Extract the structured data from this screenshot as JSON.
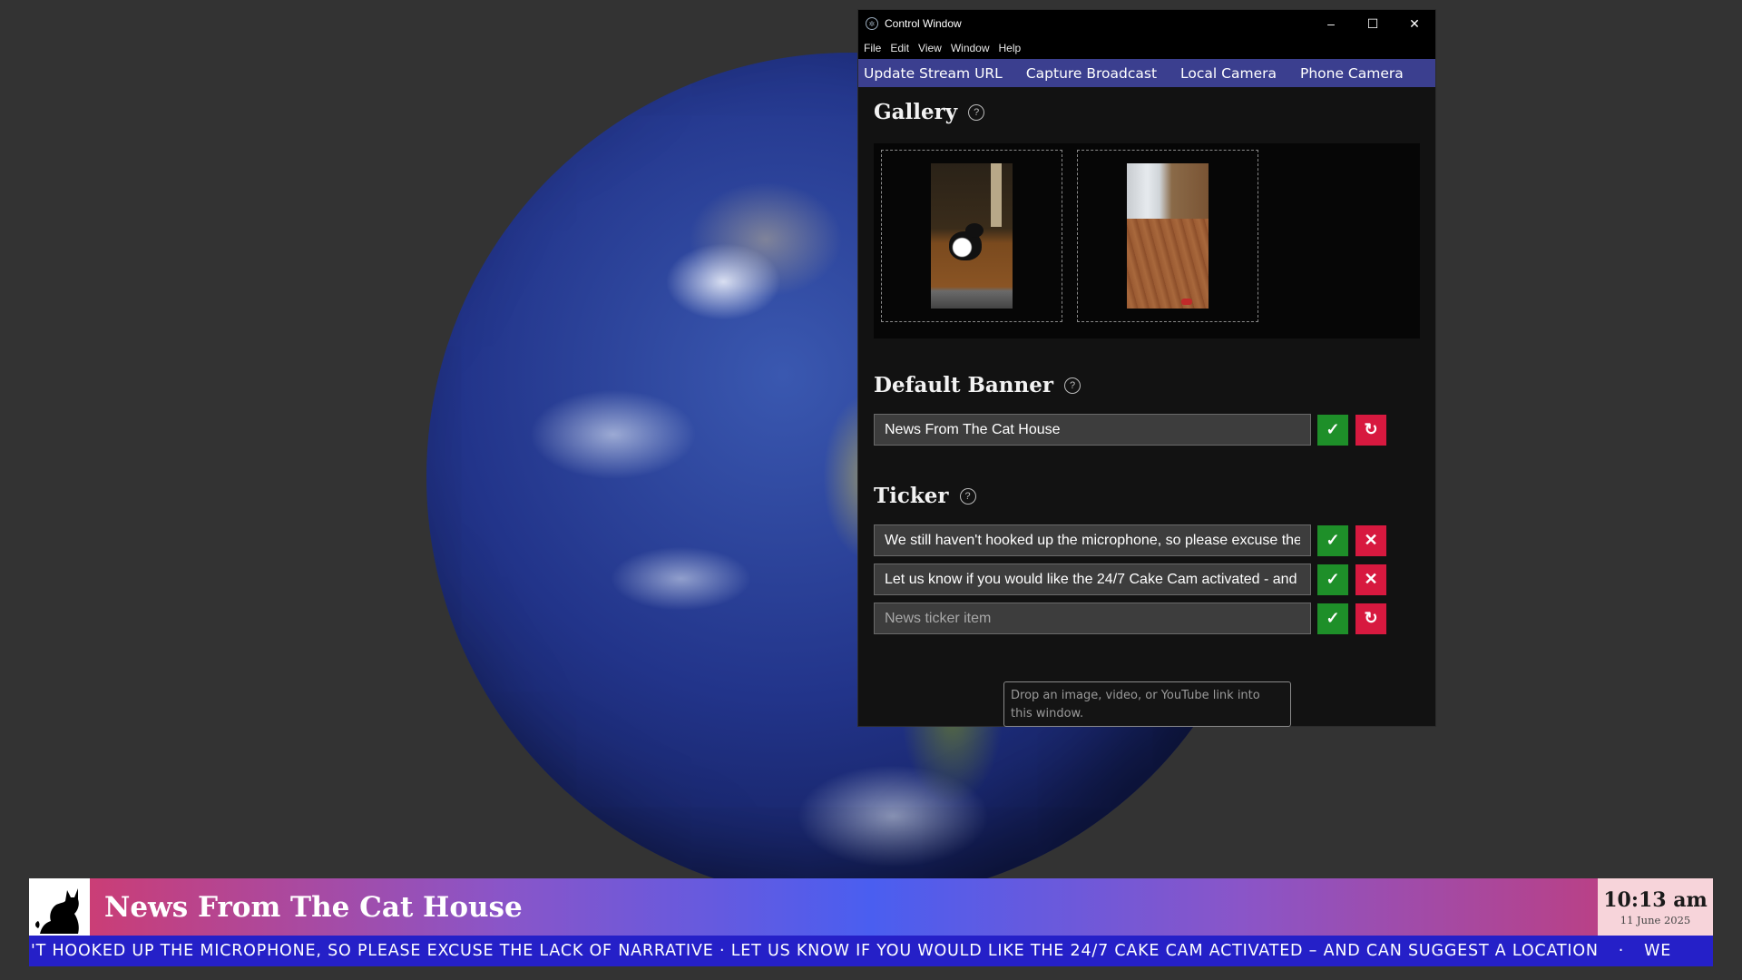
{
  "window": {
    "title": "Control Window",
    "controls": {
      "minimize": "–",
      "maximize": "☐",
      "close": "✕"
    }
  },
  "menu": [
    "File",
    "Edit",
    "View",
    "Window",
    "Help"
  ],
  "tabs": [
    "Update Stream URL",
    "Capture Broadcast",
    "Local Camera",
    "Phone Camera"
  ],
  "gallery": {
    "title": "Gallery",
    "help": "?"
  },
  "default_banner": {
    "title": "Default Banner",
    "help": "?",
    "value": "News From The Cat House",
    "confirm": "✓",
    "reset": "↻"
  },
  "ticker_section": {
    "title": "Ticker",
    "help": "?",
    "items": [
      {
        "value": "We still haven't hooked up the microphone, so please excuse the lack of narrative",
        "confirm": "✓",
        "remove": "✕"
      },
      {
        "value": "Let us know if you would like the 24/7 Cake Cam activated - and can suggest a location",
        "confirm": "✓",
        "remove": "✕"
      }
    ],
    "new_item": {
      "placeholder": "News ticker item",
      "confirm": "✓",
      "reset": "↻"
    }
  },
  "tooltip": "Drop an image, video, or YouTube link into this window.",
  "banner": {
    "title": "News From The Cat House",
    "time": "10:13 am",
    "date": "11 June 2025"
  },
  "ticker_display": {
    "text": "'T HOOKED UP THE MICROPHONE, SO PLEASE EXCUSE THE LACK OF NARRATIVE · LET US KNOW IF YOU WOULD LIKE THE 24/7 CAKE CAM ACTIVATED – AND CAN SUGGEST A LOCATION",
    "separator": "·",
    "tail": "WE"
  }
}
